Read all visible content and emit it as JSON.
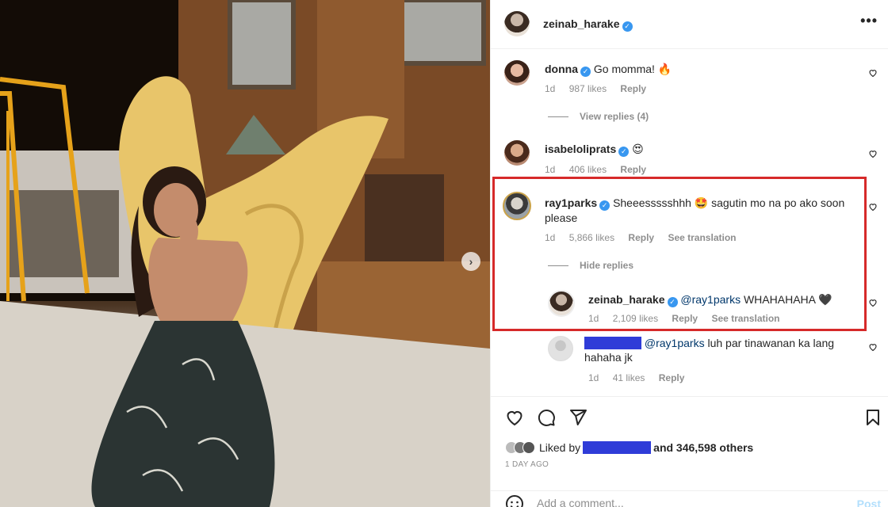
{
  "post": {
    "author": "zeinab_harake",
    "more_icon": "more-horizontal-icon",
    "next_icon": "chevron-right-icon"
  },
  "comments": [
    {
      "user": "donna",
      "verified": true,
      "text": "Go momma! 🔥",
      "time": "1d",
      "likes": "987 likes",
      "reply": "Reply",
      "replies_link": "View replies (4)"
    },
    {
      "user": "isabeloliprats",
      "verified": true,
      "text": "😍",
      "time": "1d",
      "likes": "406 likes",
      "reply": "Reply"
    },
    {
      "user": "ray1parks",
      "verified": true,
      "text_line1": "Sheeessssshhh 🤩 sagutin mo na po ako soon",
      "text_line2": "please",
      "time": "1d",
      "likes": "5,866 likes",
      "reply": "Reply",
      "translate": "See translation",
      "replies_link": "Hide replies"
    }
  ],
  "replies": [
    {
      "user": "zeinab_harake",
      "verified": true,
      "mention": "@ray1parks",
      "text": "WHAHAHAHA 🖤",
      "time": "1d",
      "likes": "2,109 likes",
      "reply": "Reply",
      "translate": "See translation"
    },
    {
      "user": "",
      "mention": "@ray1parks",
      "text": "luh par tinawanan ka lang",
      "text_line2": "hahaha jk",
      "time": "1d",
      "likes": "41 likes",
      "reply": "Reply"
    }
  ],
  "actions": {
    "like_icon": "heart-icon",
    "comment_icon": "comment-icon",
    "share_icon": "send-icon",
    "save_icon": "bookmark-icon",
    "liked_by_prefix": "Liked by",
    "liked_by_suffix": "and 346,598 others",
    "time_ago": "1 DAY AGO",
    "emoji_icon": "smiley-icon",
    "comment_placeholder": "Add a comment...",
    "post_label": "Post"
  },
  "colors": {
    "highlight_border": "#d62a2a",
    "verified_badge": "#3897f0",
    "redaction": "#2f3cd8",
    "post_button": "#b2dffc"
  }
}
